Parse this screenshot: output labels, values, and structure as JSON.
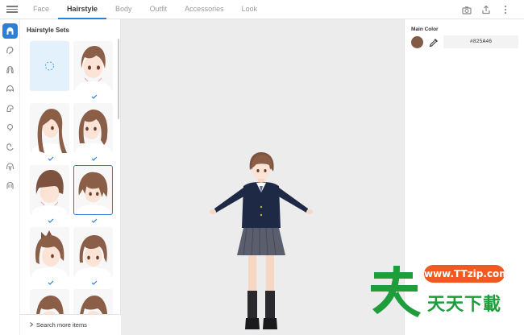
{
  "nav": {
    "tabs": [
      {
        "label": "Face"
      },
      {
        "label": "Hairstyle"
      },
      {
        "label": "Body"
      },
      {
        "label": "Outfit"
      },
      {
        "label": "Accessories"
      },
      {
        "label": "Look"
      }
    ],
    "active_tab": "Hairstyle",
    "accent_color": "#2b7fd9"
  },
  "top_actions": [
    "camera-icon",
    "export-icon",
    "more-vertical-icon"
  ],
  "left_toolbar": {
    "items": [
      "hair-front-icon",
      "hair-side-icon",
      "hair-back-icon",
      "hair-top-icon",
      "hair-extra-1-icon",
      "hair-extra-2-icon",
      "hair-extra-3-icon",
      "hair-extra-4-icon",
      "hair-extra-5-icon"
    ],
    "active_index": 0
  },
  "panel": {
    "title": "Hairstyle Sets",
    "search_more": "Search more items"
  },
  "appearance": {
    "main_color_label": "Main Color",
    "main_color_hex": "#825A46",
    "main_color_value": "#825A46"
  },
  "watermark": {
    "url": "www.TTzip.com",
    "text": "天天下載"
  }
}
